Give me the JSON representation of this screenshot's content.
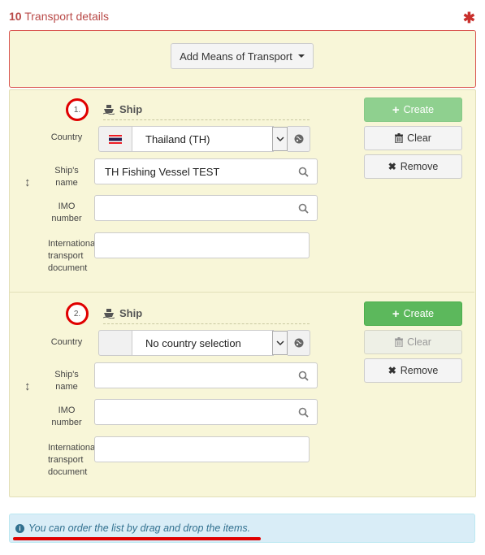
{
  "section": {
    "number": "10",
    "title": "Transport details",
    "required_mark": "✱"
  },
  "add_button": {
    "label": "Add Means of Transport"
  },
  "labels": {
    "country": "Country",
    "ships_name_1": "Ship's",
    "ships_name_2": "name",
    "imo_1": "IMO",
    "imo_2": "number",
    "itd_1": "International",
    "itd_2": "transport",
    "itd_3": "document"
  },
  "transports": [
    {
      "index": "1.",
      "type": "Ship",
      "country": "Thailand (TH)",
      "ship_name": "TH Fishing Vessel TEST",
      "imo": "",
      "itd": "",
      "buttons": {
        "create": "Create",
        "clear": "Clear",
        "remove": "Remove"
      }
    },
    {
      "index": "2.",
      "type": "Ship",
      "country": "No country selection",
      "ship_name": "",
      "imo": "",
      "itd": "",
      "buttons": {
        "create": "Create",
        "clear": "Clear",
        "remove": "Remove"
      }
    }
  ],
  "info": {
    "text": "You can order the list by drag and drop the items."
  },
  "colors": {
    "required": "#c9302c",
    "create": "#5cb85c",
    "info_bg": "#d9edf7",
    "highlight": "#e00000"
  }
}
